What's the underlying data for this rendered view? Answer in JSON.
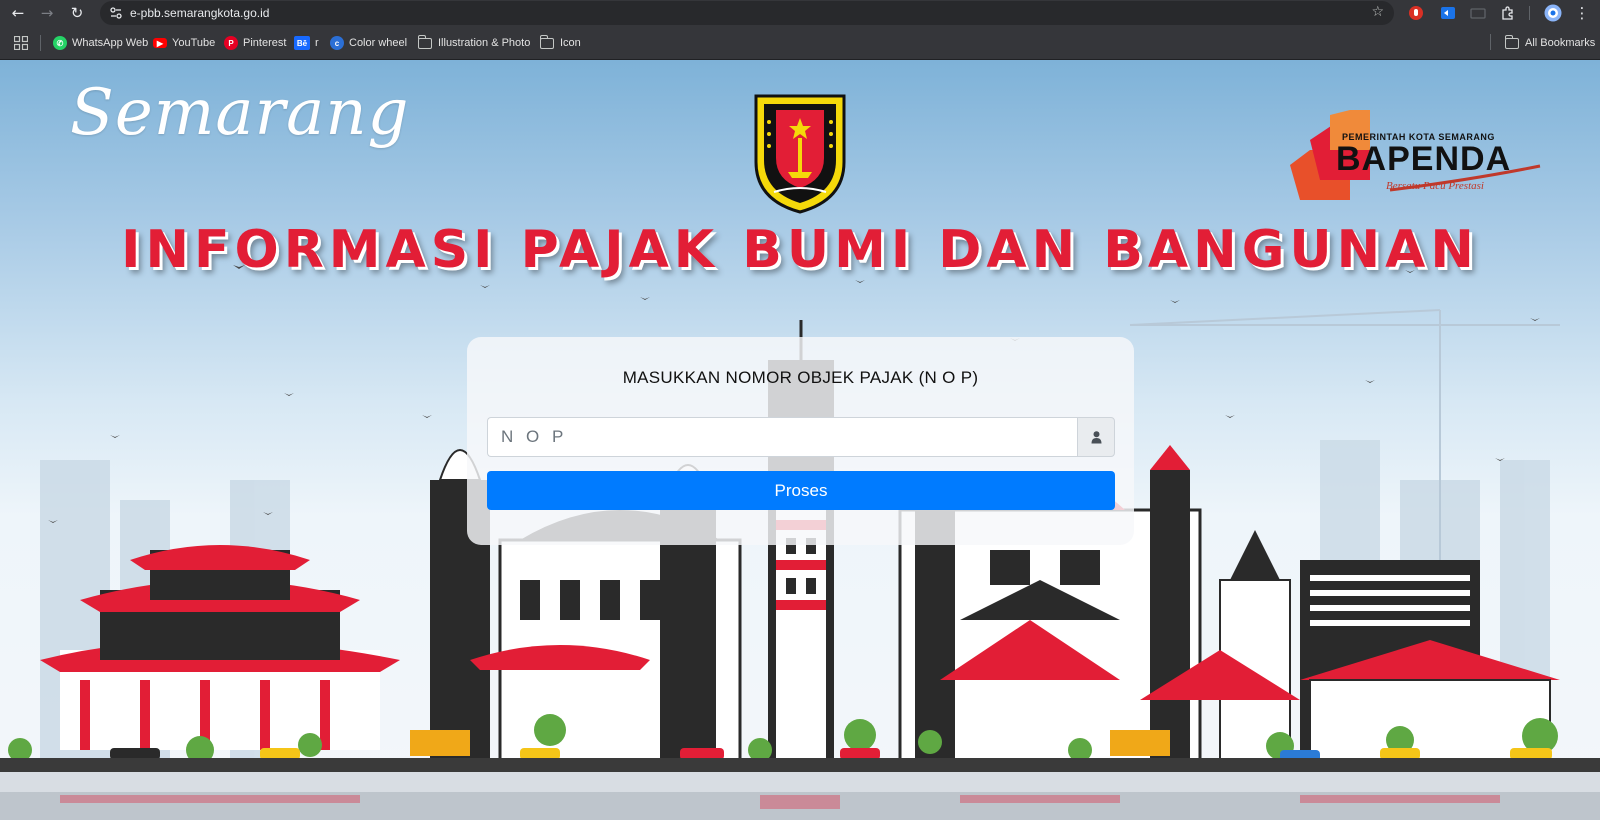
{
  "browser": {
    "url": "e-pbb.semarangkota.go.id",
    "bookmarks": [
      {
        "label": "WhatsApp Web",
        "icon": "whatsapp-icon",
        "color": "#25d366"
      },
      {
        "label": "YouTube",
        "icon": "youtube-icon",
        "color": "#ff0000"
      },
      {
        "label": "Pinterest",
        "icon": "pinterest-icon",
        "color": "#e60023"
      },
      {
        "label": "r",
        "icon": "behance-icon",
        "color": "#1769ff"
      },
      {
        "label": "Color wheel",
        "icon": "color-wheel-icon",
        "color": "#2b6fd6"
      },
      {
        "label": "Illustration & Photo",
        "icon": "folder-icon"
      },
      {
        "label": "Icon",
        "icon": "folder-icon"
      }
    ],
    "all_bookmarks": "All Bookmarks"
  },
  "header": {
    "script_logo": "Semarang",
    "bapenda_sub": "PEMERINTAH KOTA SEMARANG",
    "bapenda_name": "BAPENDA",
    "bapenda_tagline": "Bersatu Pacu Prestasi",
    "banner": "INFORMASI PAJAK BUMI DAN BANGUNAN"
  },
  "form": {
    "title": "MASUKKAN NOMOR OBJEK PAJAK (N O P)",
    "nop_placeholder": "N O P",
    "submit_label": "Proses"
  },
  "colors": {
    "banner_red": "#e21e36",
    "button_blue": "#007bff"
  }
}
